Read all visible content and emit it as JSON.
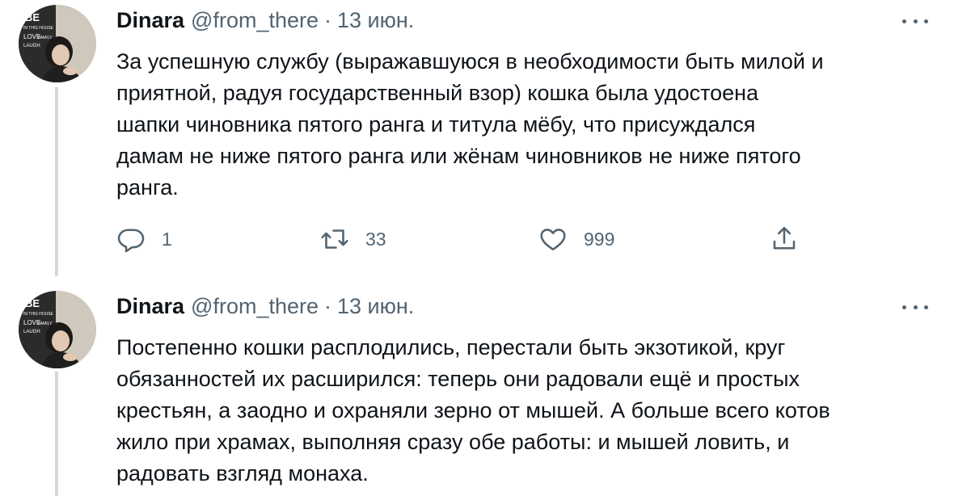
{
  "tweets": [
    {
      "author_name": "Dinara",
      "handle": "@from_there",
      "separator": "·",
      "date": "13 июн.",
      "text_lines": [
        "За успешную службу (выражавшуюся в необходимости быть милой и",
        "приятной, радуя государственный взор) кошка была удостоена",
        "шапки чиновника пятого ранга и титула мёбу, что присуждался",
        "дамам не ниже пятого ранга или жёнам чиновников не ниже пятого",
        "ранга."
      ],
      "actions": {
        "replies": "1",
        "retweets": "33",
        "likes": "999"
      }
    },
    {
      "author_name": "Dinara",
      "handle": "@from_there",
      "separator": "·",
      "date": "13 июн.",
      "text_lines": [
        "Постепенно кошки расплодились, перестали быть экзотикой, круг",
        "обязанностей их расширился: теперь они радовали ещё и простых",
        "крестьян, а заодно и охраняли зерно от мышей. А больше всего котов",
        "жило при храмах, выполняя сразу обе работы: и мышей ловить, и",
        "радовать взгляд монаха."
      ]
    }
  ],
  "avatar_poster_text": [
    "BE",
    "IN THIS HOUSE",
    "LOVE",
    "FAMILY",
    "LAUGH"
  ],
  "icons": {
    "more": "more-horizontal-icon",
    "reply": "reply-icon",
    "retweet": "retweet-icon",
    "like": "heart-icon",
    "share": "share-icon"
  },
  "colors": {
    "text_primary": "#0f1419",
    "text_secondary": "#536471",
    "thread_line": "#cfd9de",
    "background": "#ffffff"
  }
}
